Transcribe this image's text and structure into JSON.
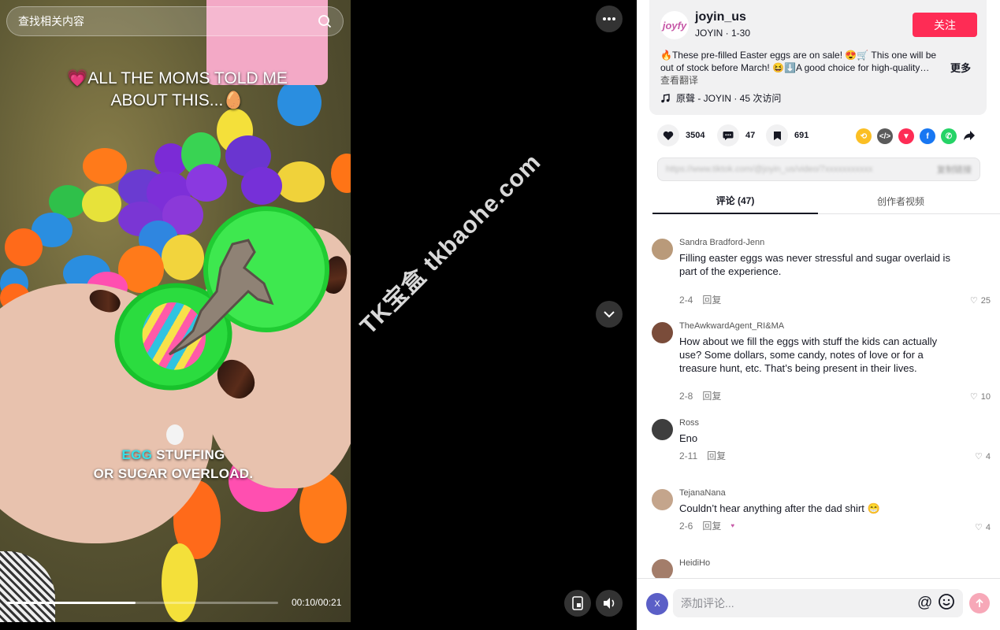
{
  "video": {
    "search_placeholder": "查找相关内容",
    "caption_top": "💗ALL THE MOMS TOLD ME ABOUT THIS...🥚",
    "caption_bottom_highlight": "EGG",
    "caption_bottom_rest1": " STUFFING",
    "caption_bottom_rest2": "OR SUGAR OVERLOAD.",
    "time": "00:10/00:21",
    "progress": 0.476,
    "watermark": "TK宝盒 tkbaohe.com"
  },
  "creator": {
    "logo_text": "joyfy",
    "username": "joyin_us",
    "subline": "JOYIN · 1-30",
    "follow_label": "关注",
    "description": "🔥These pre-filled Easter eggs are on sale! 😍🛒 This one will be out of stock before March! 😆⬇️A good choice for high-quality…",
    "more_label": "更多",
    "translate_label": "查看翻译",
    "music_icon": "music-note-icon",
    "music_label": "原聲 - JOYIN · 45 次访问"
  },
  "actions": {
    "likes": "3504",
    "comments": "47",
    "saves": "691"
  },
  "share_colors": {
    "repost": "#fbbf24",
    "embed": "#5b5b5b",
    "send": "#fe2c55",
    "facebook": "#1877f2",
    "whatsapp": "#25d366"
  },
  "link": {
    "url": "https://www.tiktok.com/@joyin_us/video/7xxxxxxxxxxx",
    "copy_label": "复制链接"
  },
  "tabs": {
    "comments": "评论 (47)",
    "creator_videos": "创作者视频"
  },
  "comments": [
    {
      "name": "Sandra Bradford-Jenn",
      "text": "Filling easter eggs was never stressful and sugar overlaid is part of the experience.",
      "date": "2-4",
      "reply": "回复",
      "likes": "25",
      "avatar_color": "#b99a7a"
    },
    {
      "name": "TheAwkwardAgent_RI&MA",
      "text": "How about we fill the eggs with stuff the kids can actually use? Some dollars, some candy, notes of love or for a treasure hunt, etc. That’s being present in their lives.",
      "date": "2-8",
      "reply": "回复",
      "likes": "10",
      "avatar_color": "#7a4c3a"
    },
    {
      "name": "Ross",
      "text": "Eno",
      "date": "2-11",
      "reply": "回复",
      "likes": "4",
      "avatar_color": "#3e3e3e"
    },
    {
      "name": "TejanaNana",
      "text": "Couldn’t hear anything after the dad shirt 😁",
      "date": "2-6",
      "reply": "回复",
      "likes": "4",
      "avatar_color": "#c4a58c"
    },
    {
      "name": "HeidiHo",
      "text": "",
      "date": "",
      "reply": "",
      "likes": "",
      "avatar_color": "#a37d6a"
    }
  ],
  "comment_bar": {
    "avatar_initial": "X",
    "placeholder": "添加评论...",
    "at_label": "@"
  }
}
